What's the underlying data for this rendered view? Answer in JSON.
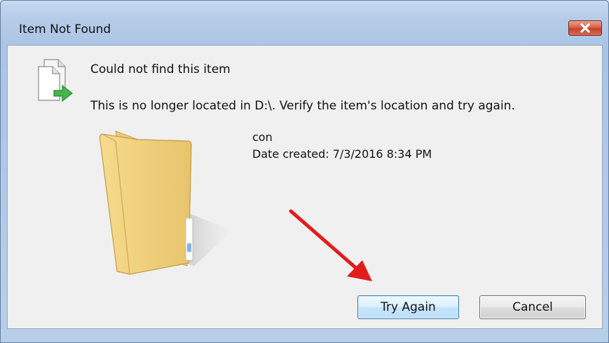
{
  "window": {
    "title": "Item Not Found"
  },
  "message": {
    "heading": "Could not find this item",
    "detail": "This is no longer located in D:\\. Verify the item's location and try again."
  },
  "item": {
    "name": "con",
    "date_created": "Date created: 7/3/2016 8:34 PM"
  },
  "buttons": {
    "try_again": "Try Again",
    "cancel": "Cancel"
  },
  "icons": {
    "header": "file-with-arrow-icon",
    "item": "folder-icon",
    "close": "close-icon",
    "annotation": "red-arrow-annotation"
  },
  "colors": {
    "annotation_arrow": "#e21b1b",
    "close_button": "#c5412c",
    "default_button_border": "#3c7fb1"
  }
}
